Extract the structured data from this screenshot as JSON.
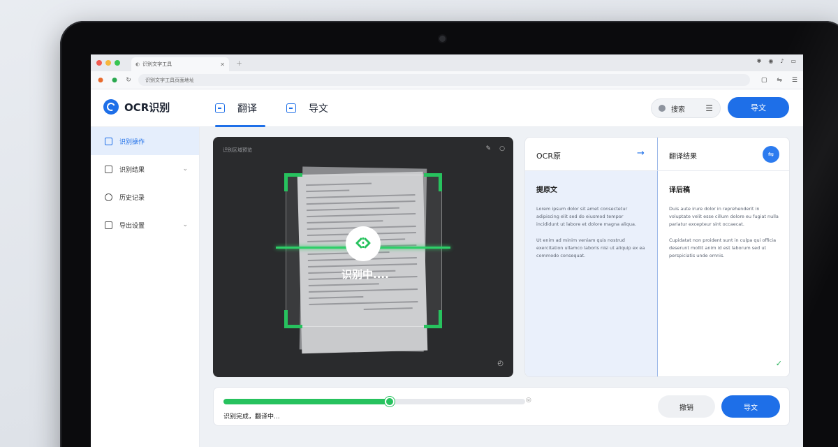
{
  "browser": {
    "tab_title": "识别文字工具",
    "address": "识别文字工具页面地址",
    "window_dot_colors": [
      "#f25b50",
      "#f6b73d",
      "#38c552"
    ]
  },
  "app": {
    "logo_text": "OCR识别",
    "tabs": [
      {
        "label": "翻译",
        "active": true
      },
      {
        "label": "导文",
        "active": false
      }
    ],
    "search_pill_label": "搜索",
    "export_label": "导文",
    "accent_color": "#1e6fe8"
  },
  "sidebar": {
    "items": [
      {
        "label": "识别操作",
        "active": true,
        "has_chevron": false
      },
      {
        "label": "识别结果",
        "active": false,
        "has_chevron": true
      },
      {
        "label": "历史记录",
        "active": false,
        "has_chevron": false
      },
      {
        "label": "导出设置",
        "active": false,
        "has_chevron": true
      }
    ]
  },
  "scan": {
    "label": "识别区域预览",
    "status": "识别中...."
  },
  "result": {
    "header_left": "OCR原",
    "header_right": "翻译结果",
    "left_title": "提原文",
    "right_title": "译后稿",
    "left_paragraphs": [
      "Lorem ipsum dolor sit amet consectetur adipiscing elit sed do eiusmod tempor incididunt ut labore et dolore magna aliqua.",
      "Ut enim ad minim veniam quis nostrud exercitation ullamco laboris nisi ut aliquip ex ea commodo consequat."
    ],
    "right_paragraphs": [
      "Duis aute irure dolor in reprehenderit in voluptate velit esse cillum dolore eu fugiat nulla pariatur excepteur sint occaecat.",
      "Cupidatat non proident sunt in culpa qui officia deserunt mollit anim id est laborum sed ut perspiciatis unde omnis."
    ]
  },
  "progress": {
    "value_percent": 55,
    "status_text": "识别完成，翻译中...",
    "secondary_label": "撤销",
    "primary_label": "导文"
  }
}
